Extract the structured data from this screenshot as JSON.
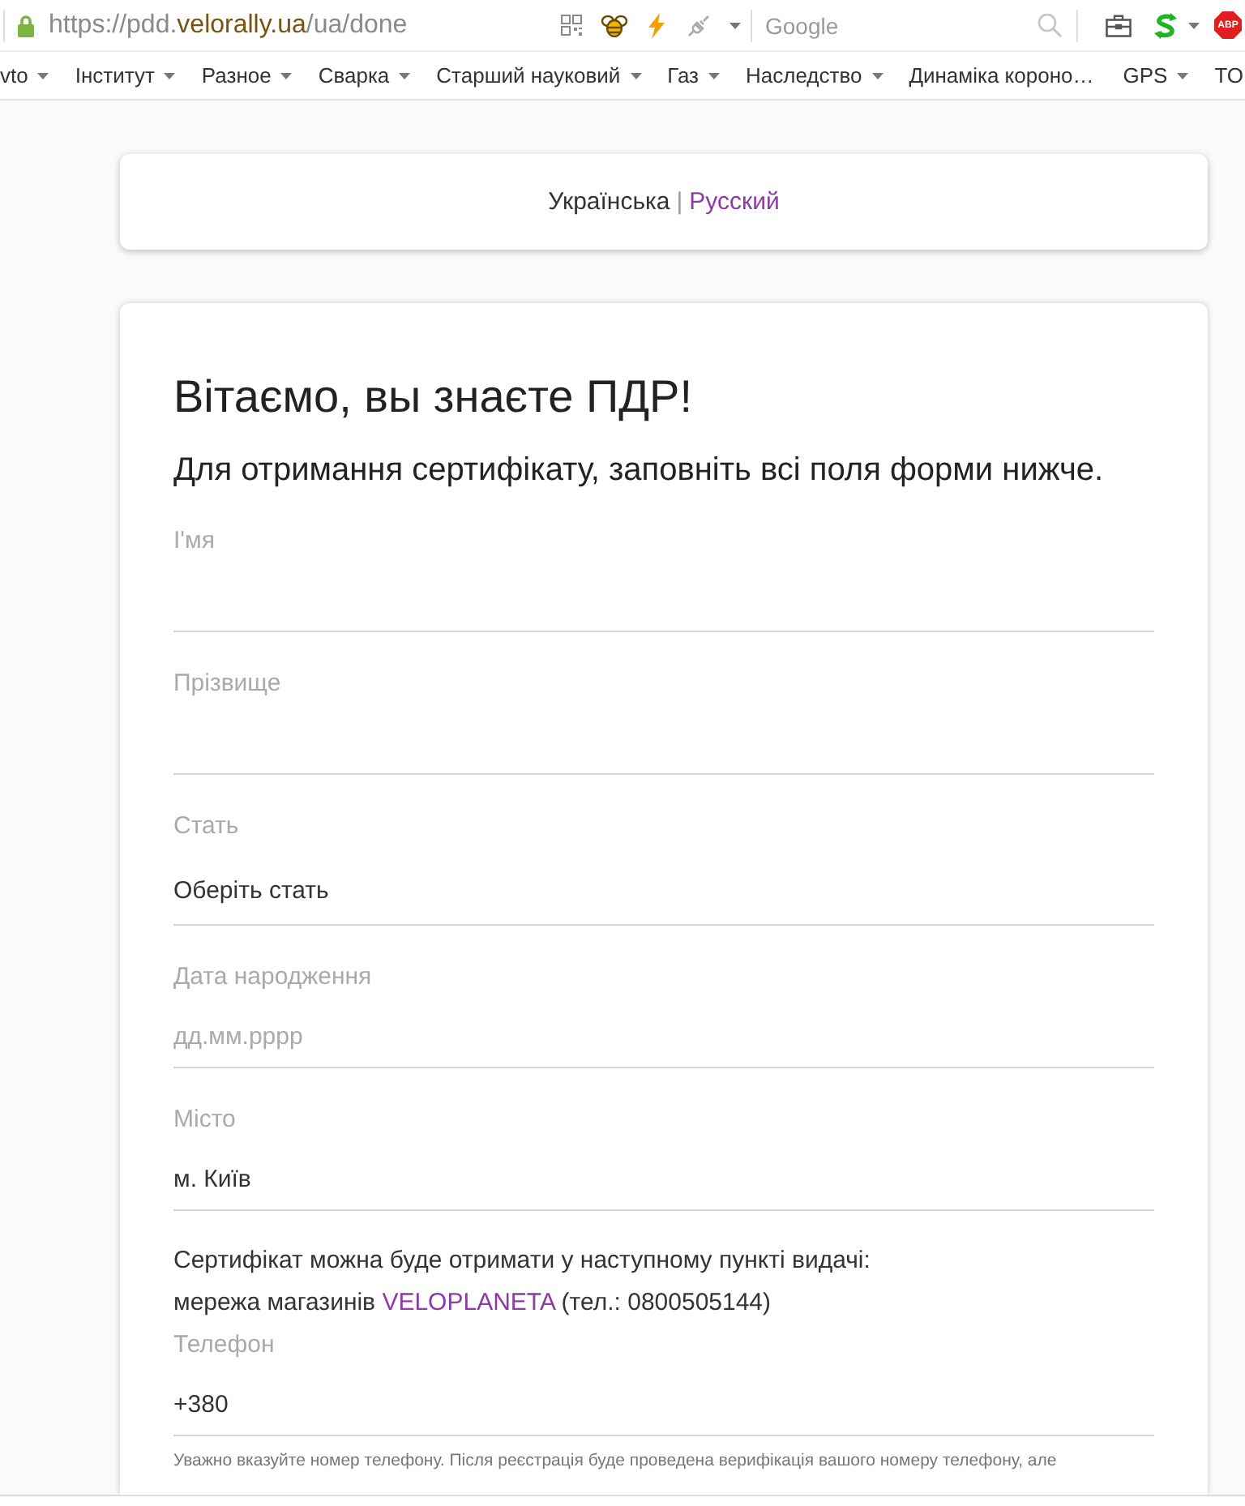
{
  "browser": {
    "url": {
      "prefix": "https://pdd.",
      "domain": "velorally.ua",
      "path": "/ua/done"
    },
    "search": {
      "placeholder": "Google"
    },
    "adblock_label": "ABP"
  },
  "bookmarks": [
    {
      "label": "vto",
      "has_menu": true
    },
    {
      "label": "Інститут",
      "has_menu": true
    },
    {
      "label": "Разное",
      "has_menu": true
    },
    {
      "label": "Сварка",
      "has_menu": true
    },
    {
      "label": "Старший науковий",
      "has_menu": true
    },
    {
      "label": "Газ",
      "has_menu": true
    },
    {
      "label": "Наследство",
      "has_menu": true
    },
    {
      "label": "Динаміка короно…",
      "has_menu": false
    },
    {
      "label": "GPS",
      "has_menu": true
    },
    {
      "label": "TO",
      "has_menu": false
    }
  ],
  "language_switch": {
    "separator": "|",
    "languages": [
      {
        "label": "Українська",
        "selected": true
      },
      {
        "label": "Русский",
        "selected": false
      }
    ]
  },
  "form": {
    "title": "Вітаємо, вы знаєте ПДР!",
    "subtitle": "Для отримання сертифікату, заповніть всі поля форми нижче.",
    "fields": [
      {
        "kind": "text",
        "label": "І'мя"
      },
      {
        "kind": "text",
        "label": "Прізвище"
      },
      {
        "kind": "select",
        "label": "Стать",
        "value": "Оберіть стать"
      },
      {
        "kind": "text",
        "label": "Дата народження",
        "placeholder": "дд.мм.рррр"
      },
      {
        "kind": "text",
        "label": "Місто",
        "value": "м. Київ"
      }
    ],
    "pickup_note": {
      "text": "Сертифікат можна буде отримати у наступному пункті видачі:",
      "store_prefix": "мережа магазинів",
      "store_link": "VELOPLANETA",
      "store_suffix": "(тел.: 0800505144)"
    },
    "phone": {
      "label": "Телефон",
      "value": "+380",
      "hint": "Уважно вказуйте номер телефону. Після реєстрація буде проведена верифікація вашого номеру телефону, але"
    }
  }
}
